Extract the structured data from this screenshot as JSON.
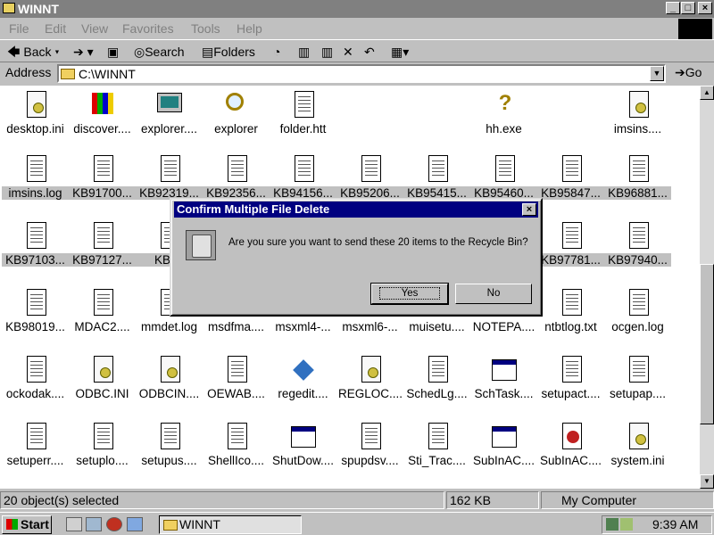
{
  "window": {
    "title": "WINNT",
    "controls": [
      "_",
      "□",
      "×"
    ]
  },
  "menu": [
    "File",
    "Edit",
    "View",
    "Favorites",
    "Tools",
    "Help"
  ],
  "toolbar": {
    "back": "Back",
    "search": "Search",
    "folders": "Folders"
  },
  "address": {
    "label": "Address",
    "value": "C:\\WINNT",
    "go": "Go"
  },
  "files": [
    {
      "name": "desktop.ini",
      "icon": "ini-icon",
      "selected": false
    },
    {
      "name": "discover....",
      "icon": "app-icon",
      "selected": false
    },
    {
      "name": "explorer....",
      "icon": "computer-icon",
      "selected": false
    },
    {
      "name": "explorer",
      "icon": "magnifier-icon",
      "selected": false
    },
    {
      "name": "folder.htt",
      "icon": "htt-icon",
      "selected": false
    },
    {
      "name": "",
      "icon": "",
      "selected": false
    },
    {
      "name": "",
      "icon": "",
      "selected": false
    },
    {
      "name": "hh.exe",
      "icon": "help-icon",
      "selected": false
    },
    {
      "name": "",
      "icon": "",
      "selected": false
    },
    {
      "name": "imsins....",
      "icon": "dll-icon",
      "selected": false
    },
    {
      "name": "imsins.log",
      "icon": "text-file-icon",
      "selected": true
    },
    {
      "name": "KB91700...",
      "icon": "text-file-icon",
      "selected": true
    },
    {
      "name": "KB92319...",
      "icon": "text-file-icon",
      "selected": true
    },
    {
      "name": "KB92356...",
      "icon": "text-file-icon",
      "selected": true
    },
    {
      "name": "KB94156...",
      "icon": "text-file-icon",
      "selected": true
    },
    {
      "name": "KB95206...",
      "icon": "text-file-icon",
      "selected": true
    },
    {
      "name": "KB95415...",
      "icon": "text-file-icon",
      "selected": true
    },
    {
      "name": "KB95460...",
      "icon": "text-file-icon",
      "selected": true
    },
    {
      "name": "KB95847...",
      "icon": "text-file-icon",
      "selected": true
    },
    {
      "name": "KB96881...",
      "icon": "text-file-icon",
      "selected": true
    },
    {
      "name": "KB97103...",
      "icon": "text-file-icon",
      "selected": true
    },
    {
      "name": "KB97127...",
      "icon": "text-file-icon",
      "selected": true
    },
    {
      "name": "KB97",
      "icon": "text-file-icon",
      "selected": true
    },
    {
      "name": "",
      "icon": "",
      "selected": false
    },
    {
      "name": "",
      "icon": "",
      "selected": false
    },
    {
      "name": "",
      "icon": "",
      "selected": false
    },
    {
      "name": "",
      "icon": "",
      "selected": false
    },
    {
      "name": "",
      "icon": "",
      "selected": false
    },
    {
      "name": "KB97781...",
      "icon": "text-file-icon",
      "selected": true
    },
    {
      "name": "KB97940...",
      "icon": "text-file-icon",
      "selected": true
    },
    {
      "name": "KB98019...",
      "icon": "text-file-icon",
      "selected": false
    },
    {
      "name": "MDAC2....",
      "icon": "text-file-icon",
      "selected": false
    },
    {
      "name": "mmdet.log",
      "icon": "text-file-icon",
      "selected": false
    },
    {
      "name": "msdfma....",
      "icon": "text-file-icon",
      "selected": false
    },
    {
      "name": "msxml4-...",
      "icon": "text-file-icon",
      "selected": false
    },
    {
      "name": "msxml6-...",
      "icon": "text-file-icon",
      "selected": false
    },
    {
      "name": "muisetu....",
      "icon": "text-file-icon",
      "selected": false
    },
    {
      "name": "NOTEPA....",
      "icon": "text-file-icon",
      "selected": false
    },
    {
      "name": "ntbtlog.txt",
      "icon": "text-file-icon",
      "selected": false
    },
    {
      "name": "ocgen.log",
      "icon": "text-file-icon",
      "selected": false
    },
    {
      "name": "ockodak....",
      "icon": "text-file-icon",
      "selected": false
    },
    {
      "name": "ODBC.INI",
      "icon": "ini-icon",
      "selected": false
    },
    {
      "name": "ODBCIN....",
      "icon": "ini-icon",
      "selected": false
    },
    {
      "name": "OEWAB....",
      "icon": "text-file-icon",
      "selected": false
    },
    {
      "name": "regedit....",
      "icon": "regedit-icon",
      "selected": false
    },
    {
      "name": "REGLOC....",
      "icon": "dll-icon",
      "selected": false
    },
    {
      "name": "SchedLg....",
      "icon": "text-file-icon",
      "selected": false
    },
    {
      "name": "SchTask....",
      "icon": "window-icon",
      "selected": false
    },
    {
      "name": "setupact....",
      "icon": "text-file-icon",
      "selected": false
    },
    {
      "name": "setupap....",
      "icon": "text-file-icon",
      "selected": false
    },
    {
      "name": "setuperr....",
      "icon": "text-file-icon",
      "selected": false
    },
    {
      "name": "setuplo....",
      "icon": "text-file-icon",
      "selected": false
    },
    {
      "name": "setupus....",
      "icon": "text-file-icon",
      "selected": false
    },
    {
      "name": "ShellIco....",
      "icon": "text-file-icon",
      "selected": false
    },
    {
      "name": "ShutDow....",
      "icon": "window-icon",
      "selected": false
    },
    {
      "name": "spupdsv....",
      "icon": "text-file-icon",
      "selected": false
    },
    {
      "name": "Sti_Trac....",
      "icon": "text-file-icon",
      "selected": false
    },
    {
      "name": "SubInAC....",
      "icon": "window-icon",
      "selected": false
    },
    {
      "name": "SubInAC....",
      "icon": "red-app-icon",
      "selected": false
    },
    {
      "name": "system.ini",
      "icon": "ini-icon",
      "selected": false
    }
  ],
  "status": {
    "selection": "20 object(s) selected",
    "size": "162 KB",
    "zone": "My Computer"
  },
  "taskbar": {
    "start": "Start",
    "task": "WINNT",
    "clock": "9:39 AM"
  },
  "dialog": {
    "title": "Confirm Multiple File Delete",
    "message": "Are you sure you want to send these 20 items to the Recycle Bin?",
    "yes": "Yes",
    "no": "No",
    "close": "×"
  }
}
